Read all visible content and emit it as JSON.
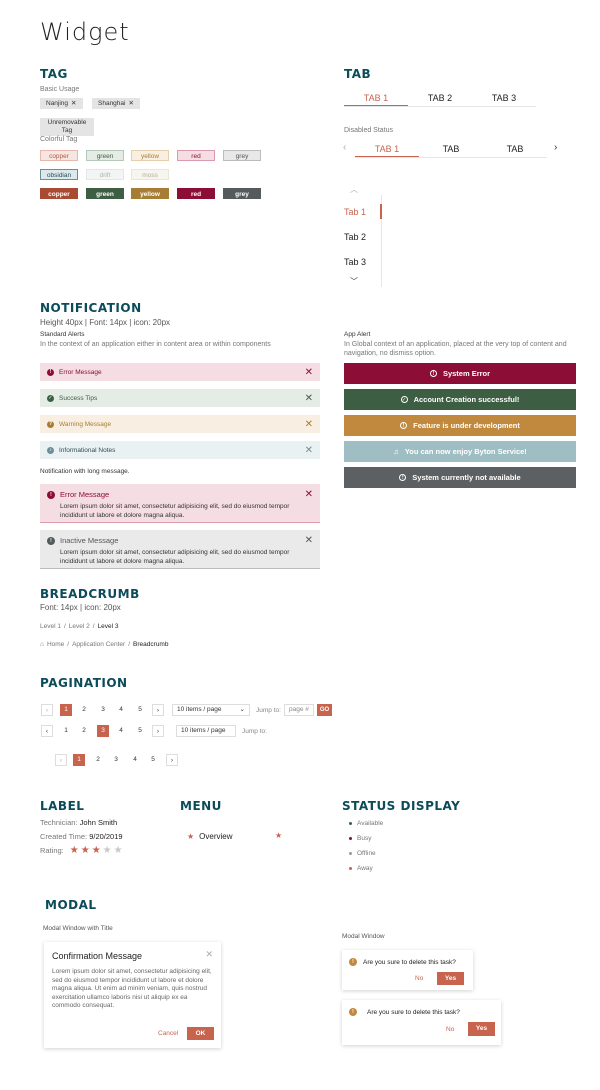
{
  "page": {
    "title": "Widget"
  },
  "tag": {
    "heading": "TAG",
    "basic_usage": "Basic Usage",
    "basic": [
      "Nanjing",
      "Shanghai"
    ],
    "unremovable": "Unremovable Tag",
    "colorful": "Colorful Tag",
    "light": [
      "copper",
      "green",
      "yellow",
      "red",
      "grey"
    ],
    "light2": [
      "obsidian",
      "drift",
      "moss"
    ],
    "solid": [
      "copper",
      "green",
      "yellow",
      "red",
      "grey"
    ]
  },
  "tab": {
    "heading": "TAB",
    "row1": [
      "TAB 1",
      "TAB 2",
      "TAB 3"
    ],
    "disabled_label": "Disabled Status",
    "row2": [
      "TAB 1",
      "TAB",
      "TAB"
    ],
    "vertical": [
      "Tab 1",
      "Tab 2",
      "Tab 3"
    ]
  },
  "notification": {
    "heading": "NOTIFICATION",
    "spec": "Height 40px | Font: 14px | icon: 20px",
    "standard": "Standard Alerts",
    "standard_desc": "In the context of an application either in content area or within components",
    "alerts": [
      "Error Message",
      "Success Tips",
      "Warning Message",
      "Informational Notes"
    ],
    "long_label": "Notification with long message.",
    "long": [
      {
        "title": "Error Message",
        "body": "Lorem ipsum dolor sit amet, consectetur adipisicing elit, sed do eiusmod tempor incididunt ut labore et dolore magna aliqua."
      },
      {
        "title": "Inactive Message",
        "body": "Lorem ipsum dolor sit amet, consectetur adipisicing elit, sed do eiusmod tempor incididunt ut labore et dolore magna aliqua."
      }
    ],
    "app_alert": "App Alert",
    "app_desc": "In Global context of an application, placed at the very top of content and navigation, no dismiss option.",
    "app_alerts": [
      "System Error",
      "Account Creation successful!",
      "Feature is under development",
      "You can now enjoy Byton Service!",
      "System currently not available"
    ]
  },
  "breadcrumb": {
    "heading": "BREADCRUMB",
    "spec": "Font: 14px | icon: 20px",
    "row1": [
      "Level 1",
      "Level 2",
      "Level 3"
    ],
    "row2": [
      "Home",
      "Application Center",
      "Breadcrumb"
    ]
  },
  "pagination": {
    "heading": "PAGINATION",
    "pages": [
      "1",
      "2",
      "3",
      "4",
      "5"
    ],
    "per_page": "10 items / page",
    "jump": "Jump to:",
    "page_placeholder": "page #",
    "go": "GO"
  },
  "label": {
    "heading": "LABEL",
    "technician_k": "Technician:",
    "technician_v": "John Smith",
    "created_k": "Created Time:",
    "created_v": "9/20/2019",
    "rating_k": "Rating:",
    "rating": 3,
    "rating_max": 5
  },
  "menu": {
    "heading": "MENU",
    "item": "Overview"
  },
  "status": {
    "heading": "STATUS DISPLAY",
    "items": [
      "Available",
      "Busy",
      "Offline",
      "Away"
    ]
  },
  "modal": {
    "heading": "MODAL",
    "with_title": "Modal Window with Title",
    "title": "Confirmation Message",
    "body": "Lorem ipsum dolor sit amet, consectetur adipisicing elit, sed do eiusmod tempor incididunt ut labore et dolore magna aliqua. Ut enim ad minim veniam, quis nostrud exercitation ullamco laboris nisi ut aliquip ex ea commodo consequat.",
    "cancel": "Cancel",
    "ok": "OK",
    "window": "Modal Window",
    "question": "Are you sure to delete this task?",
    "no": "No",
    "yes": "Yes"
  },
  "colors": {
    "copper": "#a94a33",
    "green": "#3e5e43",
    "yellow": "#a77d35",
    "red": "#8c0d35",
    "grey": "#555a5d",
    "teal": "#0b4b5a",
    "accent": "#c8634e"
  }
}
